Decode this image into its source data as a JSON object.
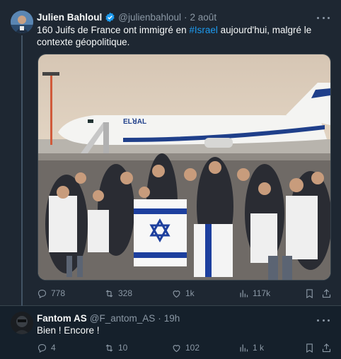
{
  "tweet": {
    "author_name": "Julien Bahloul",
    "author_handle": "@julienbahloul",
    "separator": "·",
    "time": "2 août",
    "text_before": "160 Juifs de France ont immigré en ",
    "hashtag": "#Israel",
    "text_after": " aujourd'hui, malgré le contexte géopolitique.",
    "photo_airline_text": "ELꓤAL",
    "stats": {
      "replies": "778",
      "retweets": "328",
      "likes": "1k",
      "views": "117k"
    }
  },
  "reply": {
    "author_name": "Fantom AS",
    "author_handle": "@F_antom_AS",
    "separator": "·",
    "time": "19h",
    "text": "Bien ! Encore !",
    "stats": {
      "replies": "4",
      "retweets": "10",
      "likes": "102",
      "views": "1 k"
    }
  },
  "colors": {
    "background": "#15202b",
    "card": "#1e2732",
    "accent": "#1d9bf0",
    "muted": "#8b98a5"
  },
  "icons": [
    "verified-badge-icon",
    "more-icon",
    "reply-icon",
    "retweet-icon",
    "like-icon",
    "views-icon",
    "bookmark-icon",
    "share-icon"
  ]
}
